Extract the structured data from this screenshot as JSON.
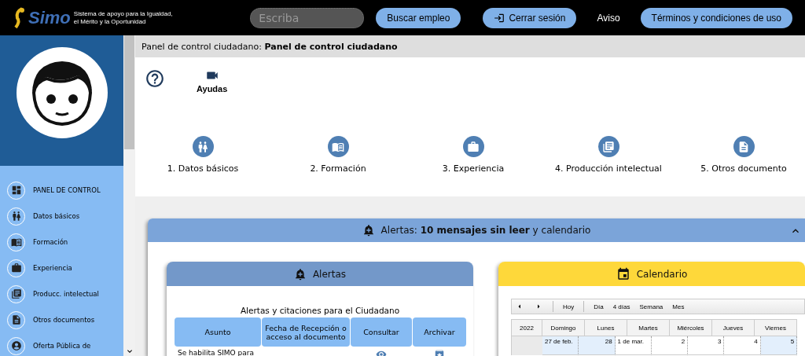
{
  "header": {
    "logo_text": "Simo",
    "tagline": [
      "Sistema de apoyo para la Igualdad,",
      "el Mérito y la Oportunidad"
    ],
    "search": {
      "placeholder": "Escriba"
    },
    "search_button": "Buscar empleo",
    "logout_button": "Cerrar sesión",
    "notice_link": "Aviso",
    "terms_button": "Términos y condiciones de uso"
  },
  "sidebar": {
    "items": [
      {
        "label": "PANEL DE CONTROL"
      },
      {
        "label": "Datos básicos"
      },
      {
        "label": "Formación"
      },
      {
        "label": "Experiencia"
      },
      {
        "label": "Producc. intelectual"
      },
      {
        "label": "Otros documentos"
      },
      {
        "label": "Oferta Pública de"
      }
    ]
  },
  "breadcrumb": "Panel de control ciudadano: **Panel de control ciudadano**",
  "help": {
    "label": "Ayudas"
  },
  "steps": [
    {
      "label": "1. Datos básicos"
    },
    {
      "label": "2. Formación"
    },
    {
      "label": "3. Experiencia"
    },
    {
      "label": "4. Producción intelectual"
    },
    {
      "label": "5. Otros documento"
    }
  ],
  "alerts_panel": {
    "title": "Alertas: **10 mensajes sin leer** y calendario",
    "expanded": true,
    "alerts": {
      "title": "Alertas",
      "caption": "Alertas y citaciones para el Ciudadano",
      "columns": [
        "Asunto",
        "Fecha de Recepción o acceso al documento",
        "Consultar",
        "Archivar"
      ],
      "rows": [
        {
          "subject": "Se habilita SIMO para"
        }
      ]
    },
    "calendar": {
      "title": "Calendario",
      "toolbar": [
        "Hoy",
        "Día",
        "4 días",
        "Semana",
        "Mes"
      ],
      "year": "2022",
      "days": [
        "Domingo",
        "Lunes",
        "Martes",
        "Miércoles",
        "Jueves",
        "Viernes"
      ],
      "dates": [
        {
          "label": "27 de feb.",
          "highlighted": true
        },
        {
          "label": "28",
          "highlighted": true
        },
        {
          "label": "1 de mar.",
          "highlighted": false
        },
        {
          "label": "2",
          "highlighted": false
        },
        {
          "label": "3",
          "highlighted": false
        },
        {
          "label": "4",
          "highlighted": false
        },
        {
          "label": "5",
          "highlighted": true
        }
      ]
    }
  }
}
